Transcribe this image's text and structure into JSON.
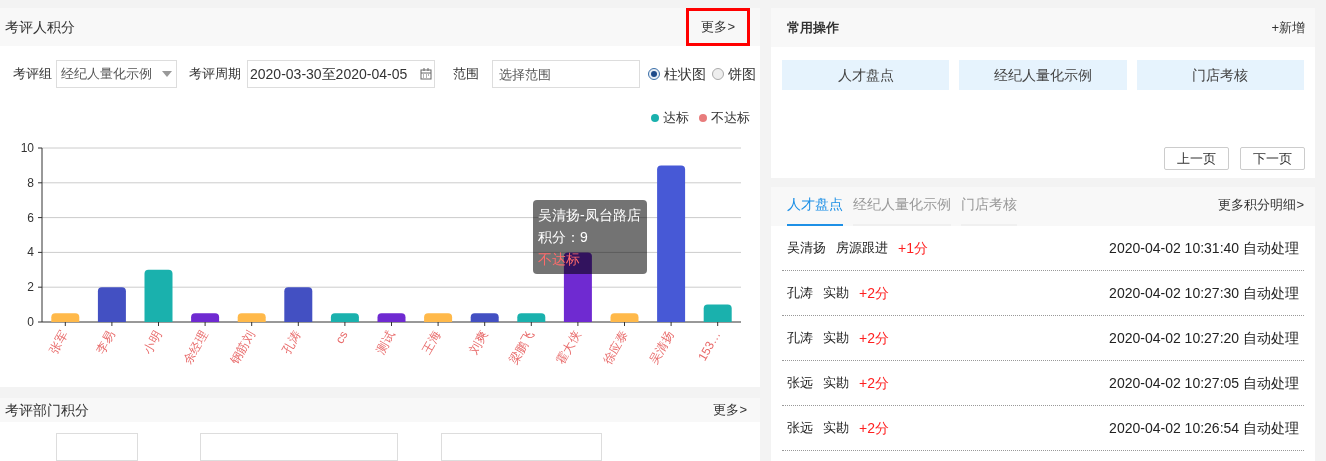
{
  "person_panel": {
    "title": "考评人积分",
    "more": {
      "label": "更多>",
      "highlighted": true
    },
    "filters": {
      "group_label": "考评组",
      "group_value": "经纪人量化示例",
      "period_label": "考评周期",
      "period_value": "2020-03-30至2020-04-05",
      "range_label": "范围",
      "range_placeholder": "选择范围",
      "chart_types": [
        {
          "label": "柱状图",
          "selected": true
        },
        {
          "label": "饼图",
          "selected": false
        }
      ]
    },
    "legend": [
      {
        "label": "达标",
        "color": "#1ab1ad"
      },
      {
        "label": "不达标",
        "color": "#e87c7c"
      }
    ],
    "chart_data": {
      "type": "bar",
      "categories": [
        "张军",
        "李易",
        "小明",
        "余经理",
        "钢筋刘",
        "孔涛",
        "cs",
        "测试",
        "王海",
        "刘爽",
        "梁鹏飞",
        "霍大侠",
        "徐应泰",
        "吴清扬",
        "153…"
      ],
      "grid": true,
      "series": [
        {
          "values": [
            0.5,
            2,
            3,
            0.5,
            0.5,
            2,
            0.5,
            0.5,
            0.5,
            0.5,
            0.5,
            4,
            0.5,
            9,
            1
          ]
        }
      ],
      "colors": [
        "#ffb94a",
        "#4350c2",
        "#1ab1ad",
        "#6f2ad1",
        "#ffb94a",
        "#4350c2",
        "#1ab1ad",
        "#6f2ad1",
        "#ffb94a",
        "#4350c2",
        "#1ab1ad",
        "#6f2ad1",
        "#ffb94a",
        "#4759d6",
        "#1ab1ad"
      ],
      "ylim": [
        0,
        10
      ],
      "yticks": [
        0,
        2,
        4,
        6,
        8,
        10
      ]
    },
    "tooltip": {
      "title": "吴清扬-凤台路店",
      "score": "积分：9",
      "status": "不达标"
    }
  },
  "department_panel": {
    "title": "考评部门积分",
    "more": {
      "label": "更多>",
      "highlighted": false
    }
  },
  "shortcuts_panel": {
    "title": "常用操作",
    "add": "+新增",
    "shortcuts": [
      "人才盘点",
      "经纪人量化示例",
      "门店考核"
    ],
    "prev": "上一页",
    "next": "下一页"
  },
  "records_panel": {
    "tabs": [
      {
        "label": "人才盘点",
        "selected": true
      },
      {
        "label": "经纪人量化示例",
        "selected": false
      },
      {
        "label": "门店考核",
        "selected": false
      }
    ],
    "more": "更多积分明细>",
    "rows": [
      {
        "name": "吴清扬",
        "action": "房源跟进",
        "points": "+1分",
        "time": "2020-04-02 10:31:40 自动处理"
      },
      {
        "name": "孔涛",
        "action": "实勘",
        "points": "+2分",
        "time": "2020-04-02 10:27:30 自动处理"
      },
      {
        "name": "孔涛",
        "action": "实勘",
        "points": "+2分",
        "time": "2020-04-02 10:27:20 自动处理"
      },
      {
        "name": "张远",
        "action": "实勘",
        "points": "+2分",
        "time": "2020-04-02 10:27:05 自动处理"
      },
      {
        "name": "张远",
        "action": "实勘",
        "points": "+2分",
        "time": "2020-04-02 10:26:54 自动处理"
      }
    ]
  }
}
